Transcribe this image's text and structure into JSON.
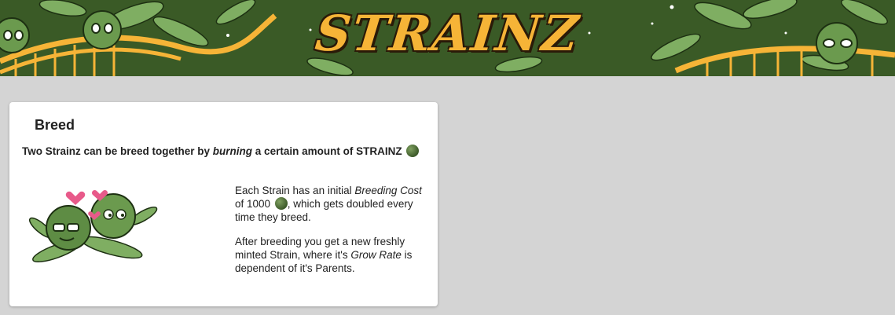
{
  "banner": {
    "logo_text": "STRAINZ"
  },
  "card": {
    "title": "Breed",
    "intro": {
      "before": "Two Strainz can be breed together by ",
      "emphasis": "burning",
      "after": " a certain amount of STRAINZ"
    },
    "p1": {
      "before": "Each Strain has an initial ",
      "emphasis": "Breeding Cost",
      "mid": " of 1000 ",
      "after": ", which gets doubled every time they breed."
    },
    "p2": {
      "before": "After breeding you get a new freshly minted Strain, where it's ",
      "emphasis": "Grow Rate",
      "after": " is dependent of it's Parents."
    }
  },
  "icons": {
    "token": "strainz-token-icon",
    "illustration": "breeding-strains-illustration"
  },
  "colors": {
    "banner_bg": "#3a5a26",
    "logo": "#f6b437",
    "page_bg": "#d4d4d4"
  }
}
